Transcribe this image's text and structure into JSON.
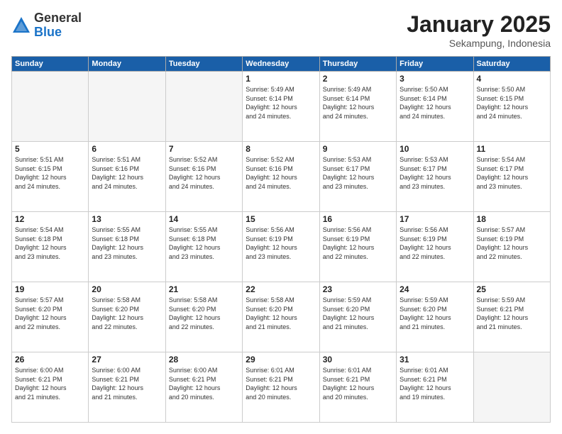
{
  "logo": {
    "general": "General",
    "blue": "Blue"
  },
  "header": {
    "title": "January 2025",
    "subtitle": "Sekampung, Indonesia"
  },
  "weekdays": [
    "Sunday",
    "Monday",
    "Tuesday",
    "Wednesday",
    "Thursday",
    "Friday",
    "Saturday"
  ],
  "weeks": [
    [
      {
        "day": "",
        "info": ""
      },
      {
        "day": "",
        "info": ""
      },
      {
        "day": "",
        "info": ""
      },
      {
        "day": "1",
        "info": "Sunrise: 5:49 AM\nSunset: 6:14 PM\nDaylight: 12 hours\nand 24 minutes."
      },
      {
        "day": "2",
        "info": "Sunrise: 5:49 AM\nSunset: 6:14 PM\nDaylight: 12 hours\nand 24 minutes."
      },
      {
        "day": "3",
        "info": "Sunrise: 5:50 AM\nSunset: 6:14 PM\nDaylight: 12 hours\nand 24 minutes."
      },
      {
        "day": "4",
        "info": "Sunrise: 5:50 AM\nSunset: 6:15 PM\nDaylight: 12 hours\nand 24 minutes."
      }
    ],
    [
      {
        "day": "5",
        "info": "Sunrise: 5:51 AM\nSunset: 6:15 PM\nDaylight: 12 hours\nand 24 minutes."
      },
      {
        "day": "6",
        "info": "Sunrise: 5:51 AM\nSunset: 6:16 PM\nDaylight: 12 hours\nand 24 minutes."
      },
      {
        "day": "7",
        "info": "Sunrise: 5:52 AM\nSunset: 6:16 PM\nDaylight: 12 hours\nand 24 minutes."
      },
      {
        "day": "8",
        "info": "Sunrise: 5:52 AM\nSunset: 6:16 PM\nDaylight: 12 hours\nand 24 minutes."
      },
      {
        "day": "9",
        "info": "Sunrise: 5:53 AM\nSunset: 6:17 PM\nDaylight: 12 hours\nand 23 minutes."
      },
      {
        "day": "10",
        "info": "Sunrise: 5:53 AM\nSunset: 6:17 PM\nDaylight: 12 hours\nand 23 minutes."
      },
      {
        "day": "11",
        "info": "Sunrise: 5:54 AM\nSunset: 6:17 PM\nDaylight: 12 hours\nand 23 minutes."
      }
    ],
    [
      {
        "day": "12",
        "info": "Sunrise: 5:54 AM\nSunset: 6:18 PM\nDaylight: 12 hours\nand 23 minutes."
      },
      {
        "day": "13",
        "info": "Sunrise: 5:55 AM\nSunset: 6:18 PM\nDaylight: 12 hours\nand 23 minutes."
      },
      {
        "day": "14",
        "info": "Sunrise: 5:55 AM\nSunset: 6:18 PM\nDaylight: 12 hours\nand 23 minutes."
      },
      {
        "day": "15",
        "info": "Sunrise: 5:56 AM\nSunset: 6:19 PM\nDaylight: 12 hours\nand 23 minutes."
      },
      {
        "day": "16",
        "info": "Sunrise: 5:56 AM\nSunset: 6:19 PM\nDaylight: 12 hours\nand 22 minutes."
      },
      {
        "day": "17",
        "info": "Sunrise: 5:56 AM\nSunset: 6:19 PM\nDaylight: 12 hours\nand 22 minutes."
      },
      {
        "day": "18",
        "info": "Sunrise: 5:57 AM\nSunset: 6:19 PM\nDaylight: 12 hours\nand 22 minutes."
      }
    ],
    [
      {
        "day": "19",
        "info": "Sunrise: 5:57 AM\nSunset: 6:20 PM\nDaylight: 12 hours\nand 22 minutes."
      },
      {
        "day": "20",
        "info": "Sunrise: 5:58 AM\nSunset: 6:20 PM\nDaylight: 12 hours\nand 22 minutes."
      },
      {
        "day": "21",
        "info": "Sunrise: 5:58 AM\nSunset: 6:20 PM\nDaylight: 12 hours\nand 22 minutes."
      },
      {
        "day": "22",
        "info": "Sunrise: 5:58 AM\nSunset: 6:20 PM\nDaylight: 12 hours\nand 21 minutes."
      },
      {
        "day": "23",
        "info": "Sunrise: 5:59 AM\nSunset: 6:20 PM\nDaylight: 12 hours\nand 21 minutes."
      },
      {
        "day": "24",
        "info": "Sunrise: 5:59 AM\nSunset: 6:20 PM\nDaylight: 12 hours\nand 21 minutes."
      },
      {
        "day": "25",
        "info": "Sunrise: 5:59 AM\nSunset: 6:21 PM\nDaylight: 12 hours\nand 21 minutes."
      }
    ],
    [
      {
        "day": "26",
        "info": "Sunrise: 6:00 AM\nSunset: 6:21 PM\nDaylight: 12 hours\nand 21 minutes."
      },
      {
        "day": "27",
        "info": "Sunrise: 6:00 AM\nSunset: 6:21 PM\nDaylight: 12 hours\nand 21 minutes."
      },
      {
        "day": "28",
        "info": "Sunrise: 6:00 AM\nSunset: 6:21 PM\nDaylight: 12 hours\nand 20 minutes."
      },
      {
        "day": "29",
        "info": "Sunrise: 6:01 AM\nSunset: 6:21 PM\nDaylight: 12 hours\nand 20 minutes."
      },
      {
        "day": "30",
        "info": "Sunrise: 6:01 AM\nSunset: 6:21 PM\nDaylight: 12 hours\nand 20 minutes."
      },
      {
        "day": "31",
        "info": "Sunrise: 6:01 AM\nSunset: 6:21 PM\nDaylight: 12 hours\nand 19 minutes."
      },
      {
        "day": "",
        "info": ""
      }
    ]
  ]
}
